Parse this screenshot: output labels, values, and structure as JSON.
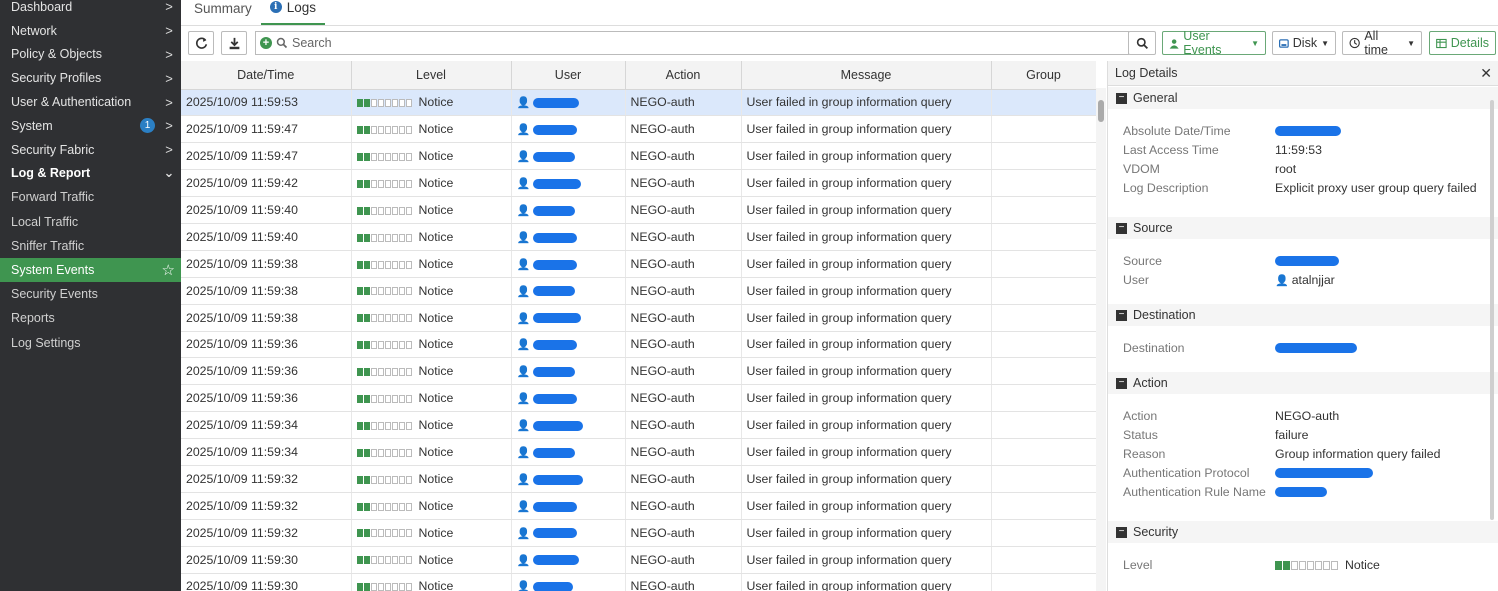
{
  "sidebar": {
    "items": [
      {
        "label": "Dashboard",
        "chevron": ">"
      },
      {
        "label": "Network",
        "chevron": ">"
      },
      {
        "label": "Policy & Objects",
        "chevron": ">"
      },
      {
        "label": "Security Profiles",
        "chevron": ">"
      },
      {
        "label": "User & Authentication",
        "chevron": ">"
      },
      {
        "label": "System",
        "chevron": ">",
        "badge": "1"
      },
      {
        "label": "Security Fabric",
        "chevron": ">"
      },
      {
        "label": "Log & Report",
        "chevron": "⌄"
      }
    ],
    "subitems": [
      {
        "label": "Forward Traffic"
      },
      {
        "label": "Local Traffic"
      },
      {
        "label": "Sniffer Traffic"
      },
      {
        "label": "System Events"
      },
      {
        "label": "Security Events"
      },
      {
        "label": "Reports"
      },
      {
        "label": "Log Settings"
      }
    ],
    "active_color": "#3f9550"
  },
  "tabs": [
    {
      "label": "Summary"
    },
    {
      "label": "Logs"
    }
  ],
  "toolbar": {
    "search_placeholder": "Search",
    "event_filter": "User Events",
    "source": "Disk",
    "time_range": "All time",
    "details_label": "Details"
  },
  "table": {
    "columns": [
      "Date/Time",
      "Level",
      "User",
      "Action",
      "Message",
      "Group"
    ],
    "rows": [
      {
        "datetime": "2025/10/09 11:59:53",
        "level": "Notice",
        "action": "NEGO-auth",
        "message": "User failed in group information query"
      },
      {
        "datetime": "2025/10/09 11:59:47",
        "level": "Notice",
        "action": "NEGO-auth",
        "message": "User failed in group information query"
      },
      {
        "datetime": "2025/10/09 11:59:47",
        "level": "Notice",
        "action": "NEGO-auth",
        "message": "User failed in group information query"
      },
      {
        "datetime": "2025/10/09 11:59:42",
        "level": "Notice",
        "action": "NEGO-auth",
        "message": "User failed in group information query"
      },
      {
        "datetime": "2025/10/09 11:59:40",
        "level": "Notice",
        "action": "NEGO-auth",
        "message": "User failed in group information query"
      },
      {
        "datetime": "2025/10/09 11:59:40",
        "level": "Notice",
        "action": "NEGO-auth",
        "message": "User failed in group information query"
      },
      {
        "datetime": "2025/10/09 11:59:38",
        "level": "Notice",
        "action": "NEGO-auth",
        "message": "User failed in group information query"
      },
      {
        "datetime": "2025/10/09 11:59:38",
        "level": "Notice",
        "action": "NEGO-auth",
        "message": "User failed in group information query"
      },
      {
        "datetime": "2025/10/09 11:59:38",
        "level": "Notice",
        "action": "NEGO-auth",
        "message": "User failed in group information query"
      },
      {
        "datetime": "2025/10/09 11:59:36",
        "level": "Notice",
        "action": "NEGO-auth",
        "message": "User failed in group information query"
      },
      {
        "datetime": "2025/10/09 11:59:36",
        "level": "Notice",
        "action": "NEGO-auth",
        "message": "User failed in group information query"
      },
      {
        "datetime": "2025/10/09 11:59:36",
        "level": "Notice",
        "action": "NEGO-auth",
        "message": "User failed in group information query"
      },
      {
        "datetime": "2025/10/09 11:59:34",
        "level": "Notice",
        "action": "NEGO-auth",
        "message": "User failed in group information query"
      },
      {
        "datetime": "2025/10/09 11:59:34",
        "level": "Notice",
        "action": "NEGO-auth",
        "message": "User failed in group information query"
      },
      {
        "datetime": "2025/10/09 11:59:32",
        "level": "Notice",
        "action": "NEGO-auth",
        "message": "User failed in group information query"
      },
      {
        "datetime": "2025/10/09 11:59:32",
        "level": "Notice",
        "action": "NEGO-auth",
        "message": "User failed in group information query"
      },
      {
        "datetime": "2025/10/09 11:59:32",
        "level": "Notice",
        "action": "NEGO-auth",
        "message": "User failed in group information query"
      },
      {
        "datetime": "2025/10/09 11:59:30",
        "level": "Notice",
        "action": "NEGO-auth",
        "message": "User failed in group information query"
      },
      {
        "datetime": "2025/10/09 11:59:30",
        "level": "Notice",
        "action": "NEGO-auth",
        "message": "User failed in group information query"
      }
    ]
  },
  "details": {
    "title": "Log Details",
    "general": {
      "title": "General",
      "last_access_label": "Last Access Time",
      "last_access": "11:59:53",
      "abs_label": "Absolute Date/Time",
      "vdom_label": "VDOM",
      "vdom": "root",
      "desc_label": "Log Description",
      "desc": "Explicit proxy user group query failed"
    },
    "source": {
      "title": "Source",
      "source_label": "Source",
      "user_label": "User",
      "user": "atalnjjar"
    },
    "destination": {
      "title": "Destination",
      "destination_label": "Destination"
    },
    "action": {
      "title": "Action",
      "action_label": "Action",
      "action": "NEGO-auth",
      "status_label": "Status",
      "status": "failure",
      "reason_label": "Reason",
      "reason": "Group information query failed",
      "proto_label": "Authentication Protocol",
      "rule_label": "Authentication Rule Name"
    },
    "security": {
      "title": "Security",
      "level_label": "Level",
      "level": "Notice"
    }
  },
  "colors": {
    "accent": "#3f9550",
    "redaction": "#1a73e8",
    "selected_row": "#dbe8fb"
  }
}
